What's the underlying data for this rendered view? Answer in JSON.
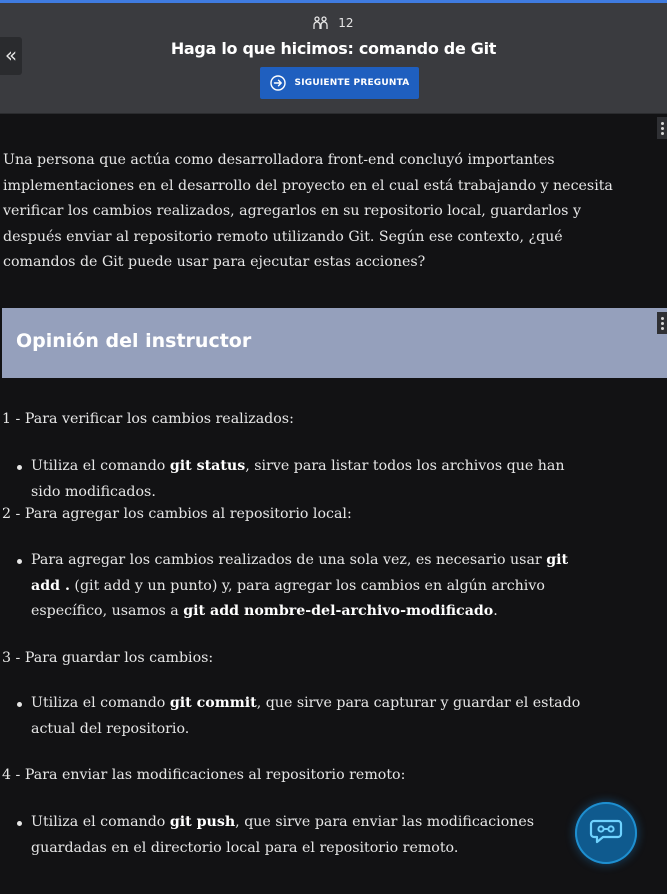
{
  "header": {
    "counter": "12",
    "title": "Haga lo que hicimos: comando de Git",
    "next_button": "SIGUIENTE PREGUNTA",
    "collapse_label": "«"
  },
  "question": "Una persona que actúa como desarrolladora front-end concluyó importantes implementaciones en el desarrollo del proyecto en el cual está trabajando y necesita verificar los cambios realizados, agregarlos en su repositorio local, guardarlos y después enviar al repositorio remoto utilizando Git. Según ese contexto, ¿qué comandos de Git puede usar para ejecutar estas acciones?",
  "opinion": {
    "title": "Opinión del instructor",
    "steps": [
      {
        "label": "1 - Para verificar los cambios realizados:",
        "bullet": {
          "before": "Utiliza el comando ",
          "cmd": "git status",
          "after": ", sirve para listar todos los archivos que han sido modificados."
        }
      },
      {
        "label": "2 - Para agregar los cambios al repositorio local:",
        "bullet": {
          "before": "Para agregar los cambios realizados de una sola vez, es necesario usar ",
          "cmd": "git add .",
          "middle": " (git add y un punto) y, para agregar los cambios en algún archivo específico, usamos a ",
          "cmd2": "git add nombre-del-archivo-modificado",
          "after": "."
        }
      },
      {
        "label": "3 - Para guardar los cambios:",
        "bullet": {
          "before": "Utiliza el comando ",
          "cmd": "git commit",
          "after": ", que sirve para capturar y guardar el estado actual del repositorio."
        }
      },
      {
        "label": "4 - Para enviar las modificaciones al repositorio remoto:",
        "bullet": {
          "before": "Utiliza el comando ",
          "cmd": "git push",
          "after": ", que sirve para enviar las modificaciones guardadas en el directorio local para el repositorio remoto."
        }
      }
    ]
  },
  "icons": {
    "counter": "people-icon",
    "next": "arrow-circle-right-icon",
    "chat": "chat-bot-icon"
  },
  "colors": {
    "header_bg": "#3a3b3f",
    "button_bg": "#1f5fbf",
    "banner_bg": "#95a0bc",
    "page_bg": "#121214",
    "accent_line": "#3f7be0"
  }
}
